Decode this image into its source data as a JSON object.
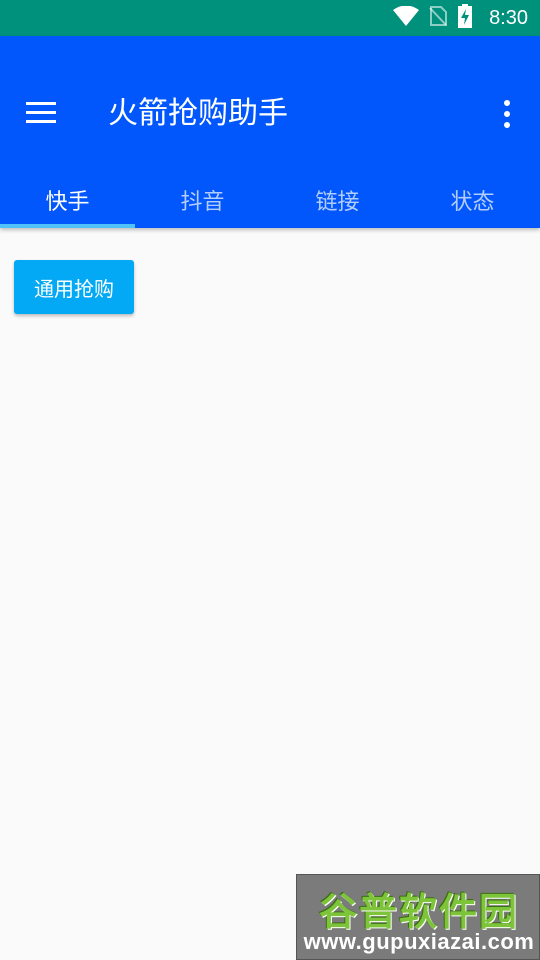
{
  "status_bar": {
    "time": "8:30",
    "icons": [
      "wifi-icon",
      "no-sim-icon",
      "battery-charging-icon"
    ]
  },
  "app_bar": {
    "title": "火箭抢购助手",
    "menu_icon": "hamburger-menu-icon",
    "overflow_icon": "more-vert-icon",
    "color": "#0157fc"
  },
  "tabs": [
    {
      "label": "快手",
      "active": true
    },
    {
      "label": "抖音",
      "active": false
    },
    {
      "label": "链接",
      "active": false
    },
    {
      "label": "状态",
      "active": false
    }
  ],
  "main": {
    "button_label": "通用抢购",
    "button_color": "#03a9f4"
  },
  "watermark": {
    "title": "谷普软件园",
    "url": "www.gupuxiazai.com"
  }
}
